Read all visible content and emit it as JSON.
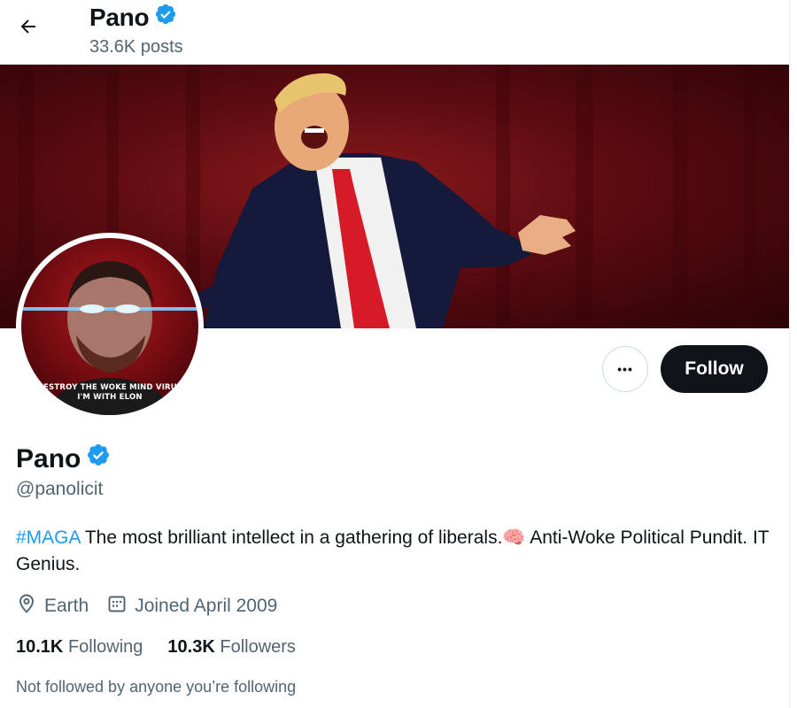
{
  "header": {
    "name": "Pano",
    "posts": "33.6K posts"
  },
  "avatar": {
    "caption_line1": "DESTROY THE WOKE MIND VIRUS",
    "caption_line2": "I'M WITH ELON"
  },
  "actions": {
    "more_label": "•••",
    "follow_label": "Follow"
  },
  "profile": {
    "name": "Pano",
    "handle": "@panolicit",
    "bio_tag": "#MAGA",
    "bio_text": " The most brilliant intellect in a gathering of liberals.🧠 Anti-Woke Political Pundit. IT Genius.",
    "location": "Earth",
    "joined": "Joined April 2009",
    "following_count": "10.1K",
    "following_label": "Following",
    "followers_count": "10.3K",
    "followers_label": "Followers",
    "not_followed_text": "Not followed by anyone you’re following"
  },
  "colors": {
    "accent": "#1d9bf0",
    "text": "#0f1419",
    "muted": "#536471",
    "border": "#cfd9de",
    "follow_bg": "#0f1419"
  },
  "icons": [
    "back-arrow-icon",
    "verified-badge-icon",
    "location-pin-icon",
    "calendar-icon",
    "more-dots-icon"
  ]
}
